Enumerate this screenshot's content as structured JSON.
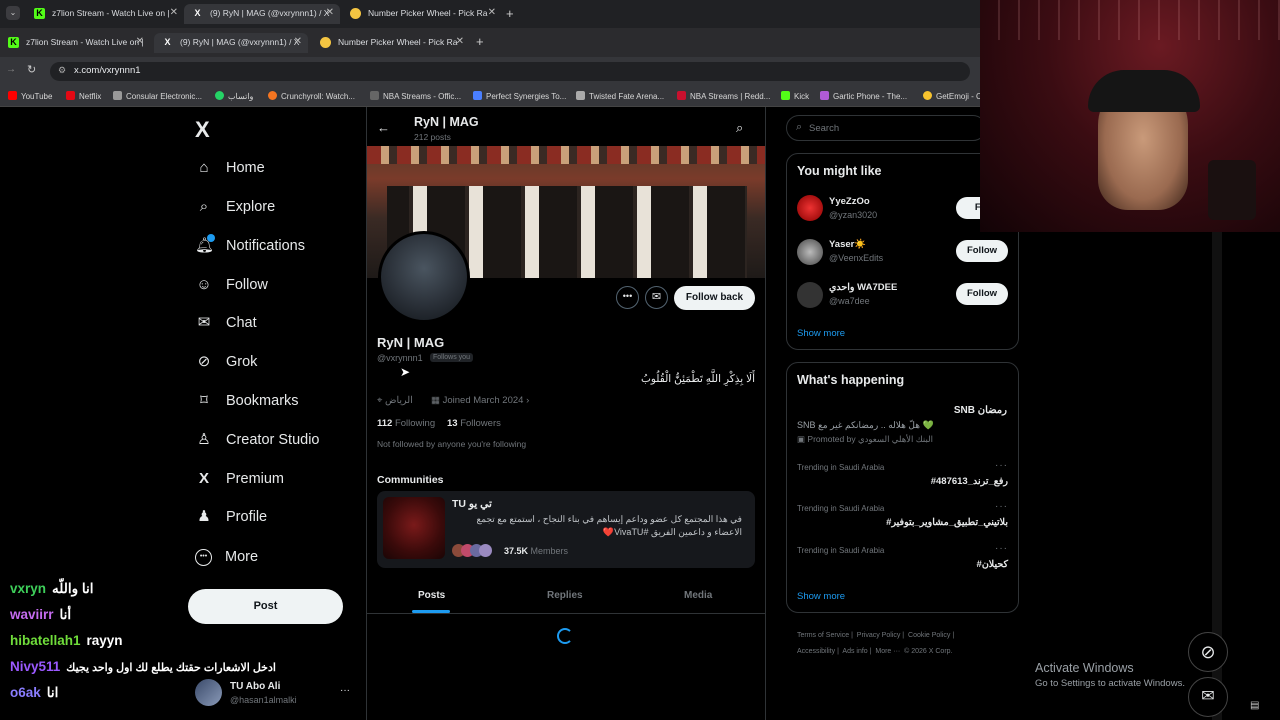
{
  "browser": {
    "tabs_row1": [
      {
        "label": "z7lion Stream - Watch Live on |",
        "active": false
      },
      {
        "label": "(9) RyN | MAG (@vxrynnn1) / X",
        "active": true
      },
      {
        "label": "Number Picker Wheel - Pick Ra",
        "active": false
      }
    ],
    "tabs_row2": [
      {
        "label": "z7lion Stream - Watch Live on |",
        "active": false
      },
      {
        "label": "(9) RyN | MAG (@vxrynnn1) / X",
        "active": true
      },
      {
        "label": "Number Picker Wheel - Pick Ra",
        "active": false
      }
    ],
    "url": "x.com/vxrynnn1",
    "bookmarks": [
      "YouTube",
      "Netflix",
      "Consular Electronic...",
      "واتساب",
      "Crunchyroll: Watch...",
      "NBA Streams - Offic...",
      "Perfect Synergies To...",
      "Twisted Fate Arena...",
      "NBA Streams | Redd...",
      "Kick",
      "Gartic Phone - The...",
      "GetEmoji - C"
    ]
  },
  "nav": {
    "logo": "X",
    "items": [
      "Home",
      "Explore",
      "Notifications",
      "Follow",
      "Chat",
      "Grok",
      "Bookmarks",
      "Creator Studio",
      "Premium",
      "Profile",
      "More"
    ],
    "post_label": "Post",
    "account_name": "TU Abo Ali",
    "account_handle": "@hasan1almalki",
    "account_more": "···"
  },
  "profile": {
    "header_name": "RyN | MAG",
    "header_posts": "212 posts",
    "name": "RyN | MAG",
    "handle": "@vxrynnn1",
    "follows_you": "Follows you",
    "bio": "أَلَا بِذِكْرِ اللَّهِ تَطْمَئِنُّ الْقُلُوبُ",
    "location": "الرياض",
    "joined": "Joined March 2024",
    "following_count": "112",
    "following_label": "Following",
    "followers_count": "13",
    "followers_label": "Followers",
    "not_followed": "Not followed by anyone you're following",
    "follow_back": "Follow back",
    "communities_title": "Communities",
    "community_name": "TU تي يو",
    "community_desc": "في هذا المجتمع كل عضو وداعم إيساهم في بناء النجاح ، استمتع مع تجمع الاعضاء و داعمين الفريق #VivaTU❤️",
    "community_members": "37.5K",
    "community_members_label": "Members",
    "tabs": [
      "Posts",
      "Replies",
      "Media"
    ]
  },
  "right": {
    "search_placeholder": "Search",
    "might_like_title": "You might like",
    "suggestions": [
      {
        "name": "YyeZzOo",
        "handle": "@yzan3020",
        "button": "Fol"
      },
      {
        "name": "Yaser☀️",
        "handle": "@VeenxEdits",
        "button": "Follow"
      },
      {
        "name": "واحدي WA7DEE",
        "handle": "@wa7dee",
        "button": "Follow"
      }
    ],
    "show_more_1": "Show more",
    "happening_title": "What's happening",
    "promo_title": "رمضان SNB",
    "promo_sub": "SNB هلّ هلاله .. رمضانكم غير مع 💚",
    "promo_by": "Promoted by البنك الأهلي السعودي",
    "trends": [
      {
        "label": "Trending in Saudi Arabia",
        "title": "#رفع_ترند_487613"
      },
      {
        "label": "Trending in Saudi Arabia",
        "title": "#بلاتيني_تطبيق_مشاوير_بتوفير"
      },
      {
        "label": "Trending in Saudi Arabia",
        "title": "#كحيلان"
      }
    ],
    "show_more_2": "Show more",
    "footer": [
      "Terms of Service",
      "Privacy Policy",
      "Cookie Policy",
      "Accessibility",
      "Ads info",
      "More ···",
      "© 2026 X Corp."
    ]
  },
  "stream_chat": [
    {
      "user": "vxryn",
      "color": "#3ecf5a",
      "msg": "انا واللّه"
    },
    {
      "user": "waviirr",
      "color": "#c56cf0",
      "msg": "أنا"
    },
    {
      "user": "hibatellah1",
      "color": "#6fdc3a",
      "msg": "rayyn"
    },
    {
      "user": "Nivy511",
      "color": "#9b59ff",
      "msg": "ادخل الاشعارات حقتك يطلع لك اول واحد يجيك"
    },
    {
      "user": "o6ak",
      "color": "#8a7dff",
      "msg": "انا"
    }
  ],
  "windows": {
    "activate_title": "Activate Windows",
    "activate_sub": "Go to Settings to activate Windows."
  }
}
